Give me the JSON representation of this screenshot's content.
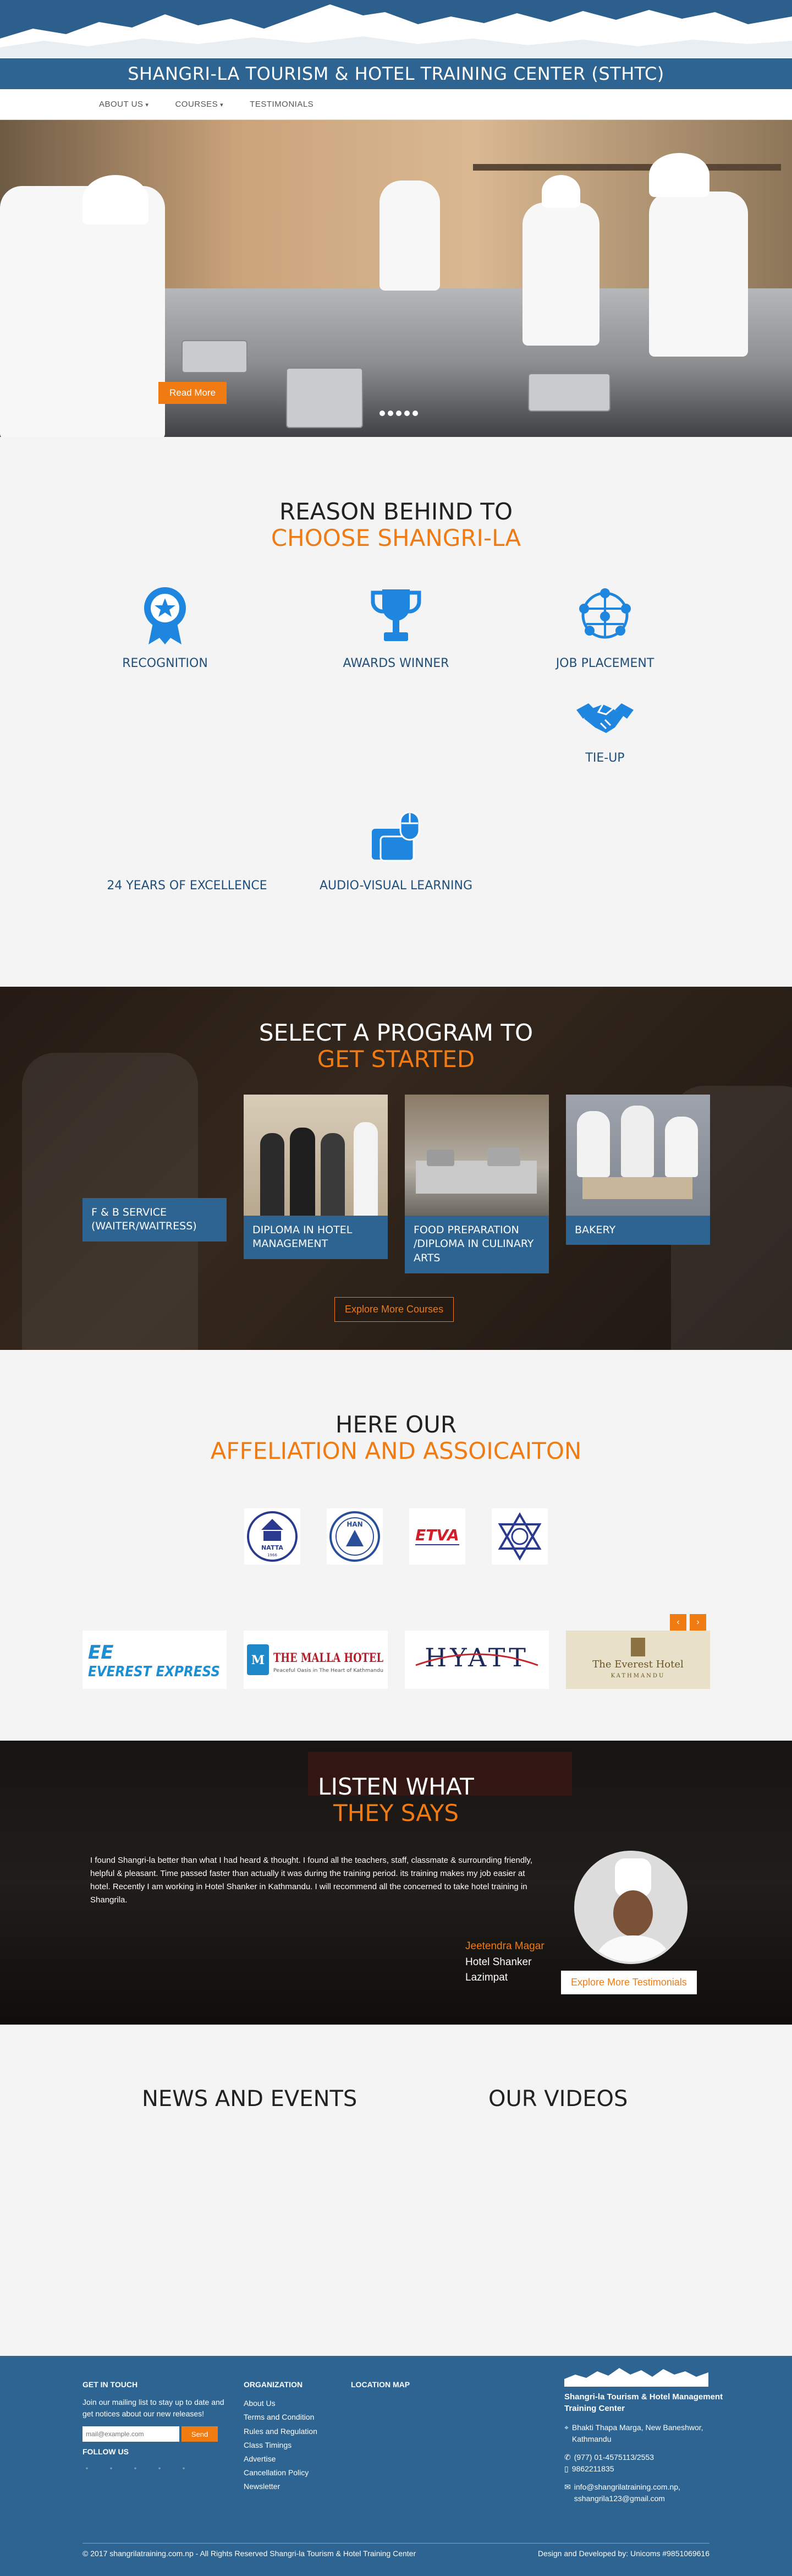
{
  "header": {
    "title": "SHANGRI-LA TOURISM & HOTEL TRAINING CENTER (STHTC)"
  },
  "nav": {
    "items": [
      {
        "label": "ABOUT US",
        "dropdown": true
      },
      {
        "label": "COURSES",
        "dropdown": true
      },
      {
        "label": "TESTIMONIALS",
        "dropdown": false
      }
    ]
  },
  "hero": {
    "button": "Read More",
    "slides": 5
  },
  "reasons": {
    "title": "REASON BEHIND TO",
    "subtitle": "CHOOSE SHANGRI-LA",
    "items": [
      {
        "label": "RECOGNITION",
        "icon": "award-ribbon-icon"
      },
      {
        "label": "AWARDS WINNER",
        "icon": "trophy-icon"
      },
      {
        "label": "JOB PLACEMENT",
        "icon": "network-globe-icon"
      },
      {
        "label": "TIE-UP",
        "icon": "handshake-icon"
      },
      {
        "label": "24 YEARS OF EXCELLENCE",
        "icon": ""
      },
      {
        "label": "AUDIO-VISUAL LEARNING",
        "icon": "mouse-folder-icon"
      }
    ]
  },
  "programs": {
    "title": "SELECT A PROGRAM TO",
    "subtitle": "GET STARTED",
    "items": [
      {
        "label": "F & B SERVICE (WAITER/WAITRESS)"
      },
      {
        "label": "DIPLOMA IN HOTEL MANAGEMENT"
      },
      {
        "label": "FOOD PREPARATION /DIPLOMA IN CULINARY ARTS"
      },
      {
        "label": "BAKERY"
      }
    ],
    "button": "Explore More Courses"
  },
  "affiliation": {
    "title": "HERE OUR",
    "subtitle": "AFFELIATION AND ASSOICAITON",
    "logos": [
      {
        "name": "NATTA",
        "sub": "1966"
      },
      {
        "name": "HAN",
        "sub": ""
      },
      {
        "name": "ETVA",
        "sub": ""
      },
      {
        "name": "",
        "sub": ""
      }
    ],
    "partners": [
      {
        "name": "EVEREST EXPRESS",
        "mark": "EE"
      },
      {
        "name": "THE MALLA HOTEL",
        "tagline": "Peaceful Oasis in The Heart of Kathmandu"
      },
      {
        "name": "HYATT"
      },
      {
        "name": "The Everest Hotel",
        "sub": "KATHMANDU"
      }
    ],
    "prev": "‹",
    "next": "›"
  },
  "testimonials": {
    "title": "LISTEN WHAT",
    "subtitle": "THEY SAYS",
    "quote": "I found Shangri-la better than what I had heard & thought. I found all the teachers, staff, classmate & surrounding friendly, helpful & pleasant. Time passed faster than actually it was during the training period. its training makes my job easier at hotel. Recently I am working in Hotel Shanker in Kathmandu. I will recommend all the concerned to take hotel training in Shangrila.",
    "name": "Jeetendra Magar",
    "workplace": "Hotel Shanker",
    "location": "Lazimpat",
    "button": "Explore More Testimonials"
  },
  "news": {
    "left": "NEWS AND EVENTS",
    "right": "OUR VIDEOS"
  },
  "footer": {
    "touch": {
      "heading": "GET IN TOUCH",
      "text": "Join our mailing list to stay up to date and get notices about our new releases!",
      "placeholder": "mail@example.com",
      "button": "Send",
      "follow": "FOLLOW US"
    },
    "organization": {
      "heading": "ORGANIZATION",
      "links": [
        "About Us",
        "Terms and Condition",
        "Rules and Regulation",
        "Class Timings",
        "Advertise",
        "Cancellation Policy",
        "Newsletter"
      ]
    },
    "map": {
      "heading": "LOCATION MAP"
    },
    "brand": {
      "name": "Shangri-la Tourism & Hotel Management Training Center",
      "address": "Bhakti Thapa Marga, New Baneshwor, Kathmandu",
      "phone1": "(977) 01-4575113/2553",
      "phone2": "9862211835",
      "email": "info@shangrilatraining.com.np, sshangrila123@gmail.com"
    },
    "copyright": "© 2017 shangrilatraining.com.np - All Rights Reserved Shangri-la Tourism & Hotel Training Center",
    "credit": "Design and Developed by: Unicoms #9851069616"
  },
  "colors": {
    "primary": "#2d6491",
    "accent": "#f07b12",
    "background": "#f4f4f4"
  }
}
